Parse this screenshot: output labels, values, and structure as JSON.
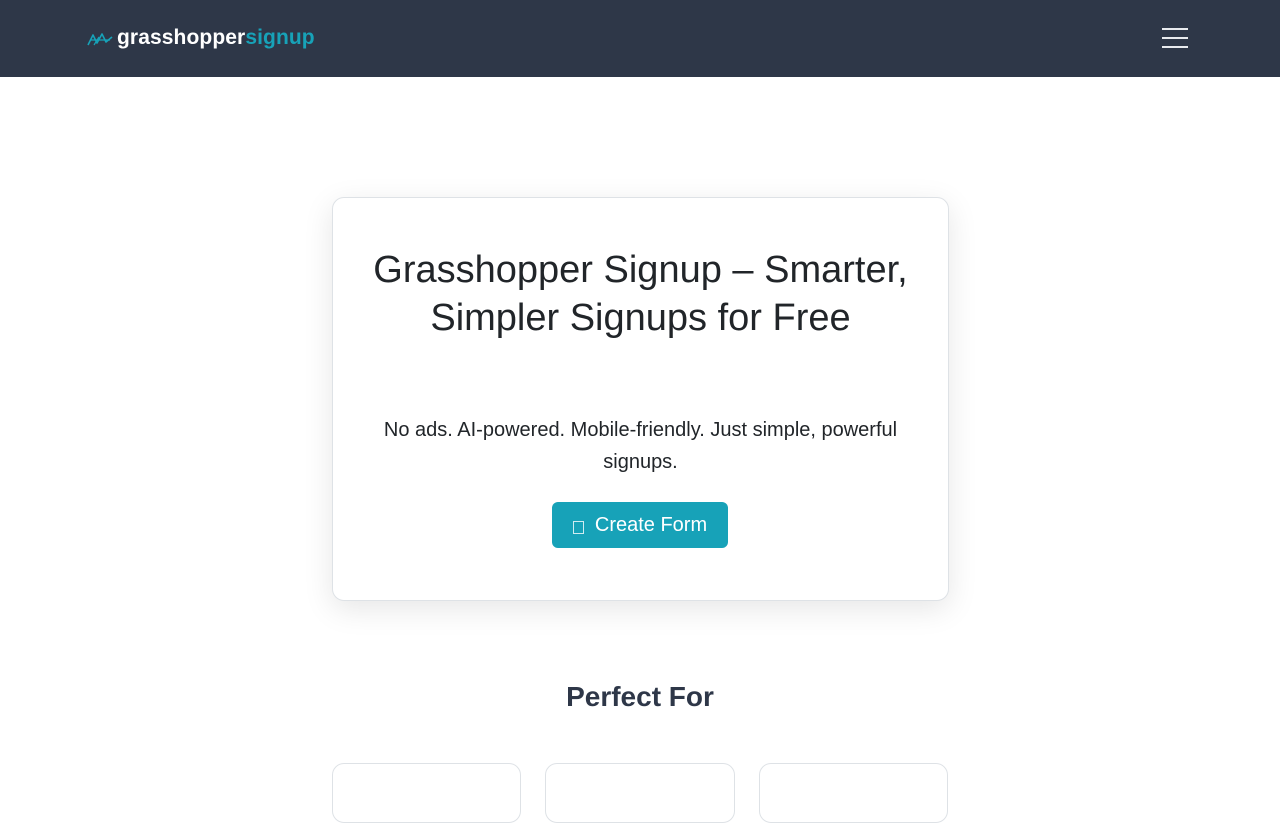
{
  "navbar": {
    "brand_part1": "grasshopper",
    "brand_part2": "signup",
    "logo_icon": "grasshopper-logo-icon",
    "menu_icon": "hamburger-menu-icon",
    "background_color": "#2e3748",
    "accent_color": "#17a2b8"
  },
  "hero": {
    "title": "Grasshopper Signup – Smarter, Simpler Signups for Free",
    "subtitle": "No ads. AI-powered. Mobile-friendly. Just simple, powerful signups.",
    "cta_label": "Create Form",
    "cta_icon": "form-icon"
  },
  "perfect_for": {
    "title": "Perfect For"
  }
}
